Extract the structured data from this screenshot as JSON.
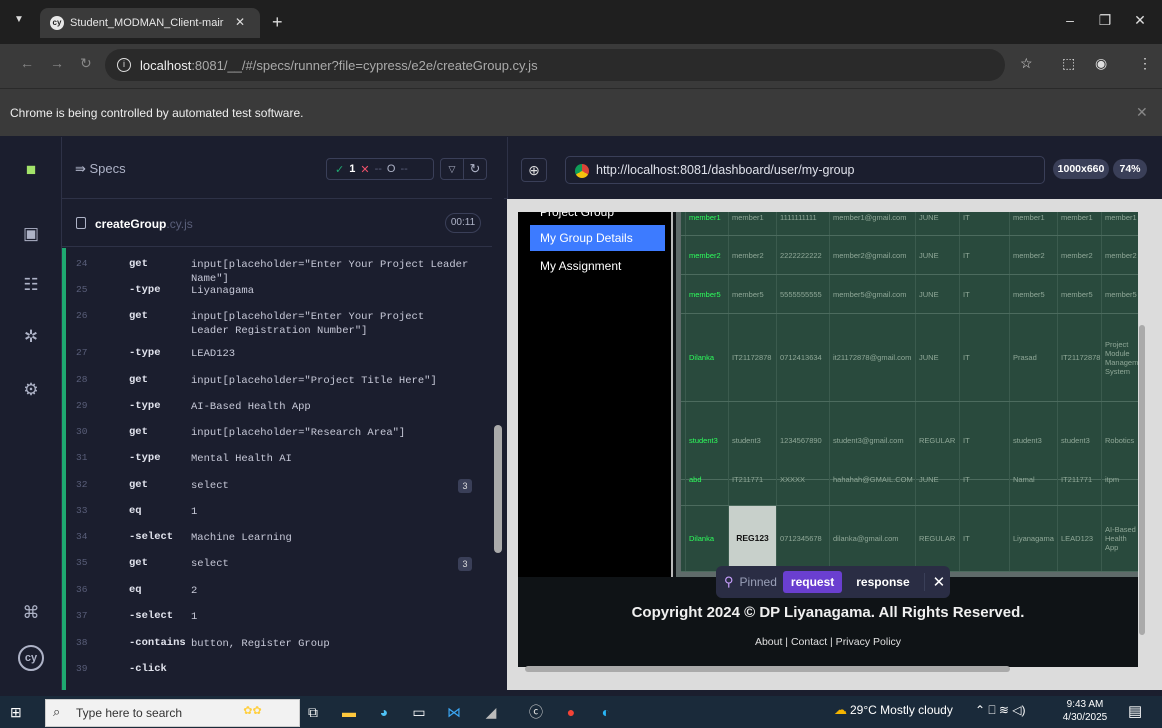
{
  "browser": {
    "tab_title": "Student_MODMAN_Client-mair",
    "url_host": "localhost",
    "url_rest": ":8081/__/#/specs/runner?file=cypress/e2e/createGroup.cy.js",
    "infobar": "Chrome is being controlled by automated test software."
  },
  "cypress": {
    "specs_label": "Specs",
    "stats": {
      "passed": "1",
      "failed": "--",
      "pending": "--"
    },
    "spec_name": "createGroup",
    "spec_ext": ".cy.js",
    "timer": "00:11",
    "commands": [
      {
        "line": "24",
        "name": "get",
        "args": "input[placeholder=\"Enter Your Project Leader Name\"]"
      },
      {
        "line": "25",
        "name": "-type",
        "args": "Liyanagama"
      },
      {
        "line": "26",
        "name": "get",
        "args": "input[placeholder=\"Enter Your Project Leader Registration Number\"]"
      },
      {
        "line": "27",
        "name": "-type",
        "args": "LEAD123"
      },
      {
        "line": "28",
        "name": "get",
        "args": "input[placeholder=\"Project Title Here\"]"
      },
      {
        "line": "29",
        "name": "-type",
        "args": "AI-Based Health App"
      },
      {
        "line": "30",
        "name": "get",
        "args": "input[placeholder=\"Research Area\"]"
      },
      {
        "line": "31",
        "name": "-type",
        "args": "Mental Health AI"
      },
      {
        "line": "32",
        "name": "get",
        "args": "select",
        "badge": "3"
      },
      {
        "line": "33",
        "name": "eq",
        "args": "1"
      },
      {
        "line": "34",
        "name": "-select",
        "args": "Machine Learning"
      },
      {
        "line": "35",
        "name": "get",
        "args": "select",
        "badge": "3"
      },
      {
        "line": "36",
        "name": "eq",
        "args": "2"
      },
      {
        "line": "37",
        "name": "-select",
        "args": "1"
      },
      {
        "line": "38",
        "name": "-contains",
        "args": "button, Register Group"
      },
      {
        "line": "39",
        "name": "-click",
        "args": ""
      }
    ],
    "aut_url": "http://localhost:8081/dashboard/user/my-group",
    "viewport": "1000x660",
    "zoom": "74%"
  },
  "app": {
    "sidebar": [
      "Project Group",
      "My Group Details",
      "My Assignment"
    ],
    "rows": [
      [
        "member1",
        "member1",
        "1111111111",
        "member1@gmail.com",
        "JUNE",
        "IT",
        "member1",
        "member1",
        "member1"
      ],
      [
        "member2",
        "member2",
        "2222222222",
        "member2@gmail.com",
        "JUNE",
        "IT",
        "member2",
        "member2",
        "member2"
      ],
      [
        "member5",
        "member5",
        "5555555555",
        "member5@gmail.com",
        "JUNE",
        "IT",
        "member5",
        "member5",
        "member5"
      ],
      [
        "Dilanka",
        "IT21172878",
        "0712413634",
        "it21172878@gmail.com",
        "JUNE",
        "IT",
        "Prasad",
        "IT21172878",
        "Project Module Management System"
      ],
      [
        "student3",
        "student3",
        "1234567890",
        "student3@gmail.com",
        "REGULAR",
        "IT",
        "student3",
        "student3",
        "Robotics"
      ],
      [
        "abd",
        "IT211771",
        "XXXXX",
        "hahahah@GMAIL.COM",
        "JUNE",
        "IT",
        "Namal",
        "IT211771",
        "itpm"
      ],
      [
        "Dilanka",
        "REG123",
        "0712345678",
        "dilanka@gmail.com",
        "REGULAR",
        "IT",
        "Liyanagama",
        "LEAD123",
        "AI-Based Health App"
      ]
    ],
    "copyright": "Copyright 2024 © DP Liyanagama. All Rights Reserved.",
    "footer_links": "About | Contact | Privacy Policy"
  },
  "pinned": {
    "label": "Pinned",
    "request": "request",
    "response": "response"
  },
  "taskbar": {
    "search_placeholder": "Type here to search",
    "weather": "29°C  Mostly cloudy",
    "time": "9:43 AM",
    "date": "4/30/2025"
  }
}
